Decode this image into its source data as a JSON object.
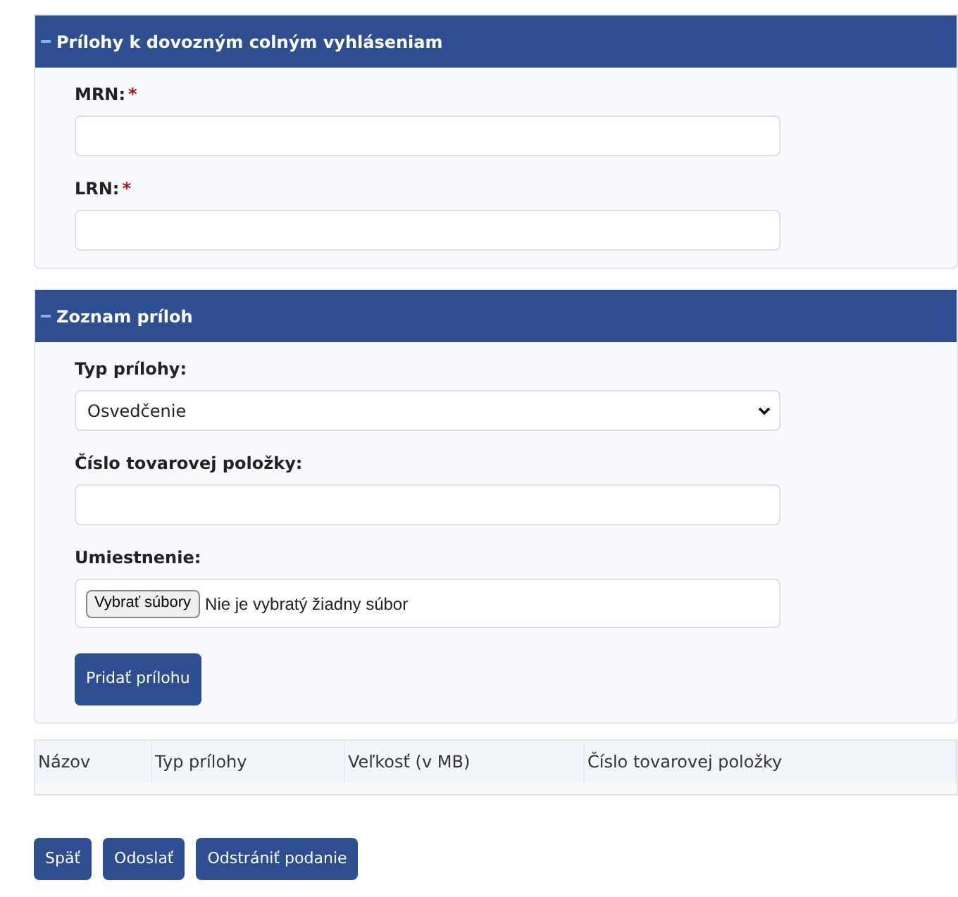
{
  "panels": [
    {
      "title": "Prílohy k dovozným colným vyhláseniam",
      "expanded": true,
      "fields": [
        {
          "kind": "text",
          "label": "MRN:",
          "marker": "*"
        },
        {
          "kind": "text",
          "label": "LRN:",
          "marker": "*"
        }
      ]
    },
    {
      "title": "Zoznam príloh",
      "expanded": true,
      "fields": [
        {
          "kind": "select",
          "label": "Typ prílohy:",
          "value": "Osvedčenie"
        },
        {
          "kind": "text",
          "label": "Číslo tovarovej položky:"
        },
        {
          "kind": "file",
          "label": "Umiestnenie:",
          "button": "Vybrať súbory",
          "status": "Nie je vybratý žiadny súbor"
        }
      ],
      "submit": "Pridať prílohu"
    }
  ],
  "table": {
    "columns": [
      "Názov",
      "Typ prílohy",
      "Veľkosť (v MB)",
      "Číslo tovarovej položky"
    ]
  },
  "buttons": [
    "Späť",
    "Odoslať",
    "Odstrániť podanie"
  ]
}
